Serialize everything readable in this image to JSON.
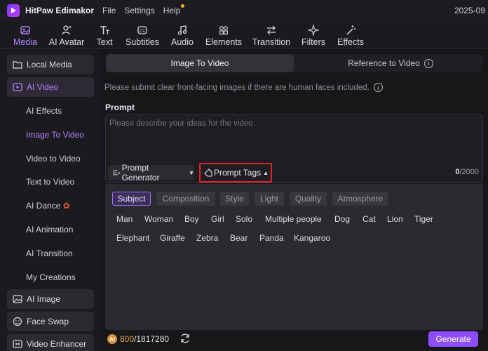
{
  "titlebar": {
    "app_name": "HitPaw Edimakor",
    "menu": [
      "File",
      "Settings",
      "Help"
    ],
    "date": "2025-09"
  },
  "toolbar": {
    "tools": [
      {
        "label": "Media",
        "icon": "media-icon",
        "active": true
      },
      {
        "label": "AI Avatar",
        "icon": "avatar-icon"
      },
      {
        "label": "Text",
        "icon": "text-icon"
      },
      {
        "label": "Subtitles",
        "icon": "subtitles-icon"
      },
      {
        "label": "Audio",
        "icon": "music-note-icon"
      },
      {
        "label": "Elements",
        "icon": "elements-icon"
      },
      {
        "label": "Transition",
        "icon": "transition-arrows-icon"
      },
      {
        "label": "Filters",
        "icon": "sparkle-icon"
      },
      {
        "label": "Effects",
        "icon": "magic-wand-icon"
      }
    ]
  },
  "sidebar": {
    "local_media": "Local Media",
    "ai_video": "AI Video",
    "sub_items": [
      "AI Effects",
      "Image To Video",
      "Video to Video",
      "Text to Video",
      "AI Dance",
      "AI Animation",
      "AI Transition",
      "My Creations"
    ],
    "active_sub": "Image To Video",
    "ai_image": "AI Image",
    "face_swap": "Face Swap",
    "video_enhancer": "Video Enhancer"
  },
  "main": {
    "tabs": [
      "Image To Video",
      "Reference to Video"
    ],
    "active_tab": "Image To Video",
    "notice": "Please submit clear front-facing images if there are human faces included.",
    "prompt_label": "Prompt",
    "prompt_placeholder": "Please describe your ideas for the video.",
    "prompt_value": "",
    "prompt_generator": "Prompt Generator",
    "prompt_tags": "Prompt Tags",
    "char_count": "0",
    "char_max": "/2000",
    "tag_categories": [
      "Subject",
      "Composition",
      "Style",
      "Light",
      "Quality",
      "Atmosphere"
    ],
    "active_category": "Subject",
    "tags_row1": [
      "Man",
      "Woman",
      "Boy",
      "Girl",
      "Solo",
      "Multiple people",
      "Dog",
      "Cat",
      "Lion",
      "Tiger"
    ],
    "tags_row2": [
      "Elephant",
      "Giraffe",
      "Zebra",
      "Bear",
      "Panda",
      "Kangaroo"
    ],
    "credits_badge": "AI",
    "credits_used": "800",
    "credits_total": "/1817280",
    "generate": "Generate"
  },
  "colors": {
    "accent": "#8a4dff",
    "accent_text": "#b583ff",
    "highlight_border": "#e0232a"
  }
}
